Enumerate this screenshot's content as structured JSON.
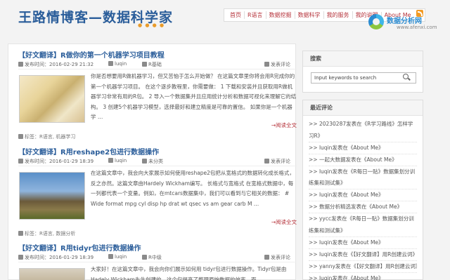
{
  "header": {
    "logo": "王路情博客—数据科学家",
    "logo_dots": "● ● ● ●"
  },
  "nav": {
    "items": [
      "首页",
      "R语言",
      "数据挖掘",
      "数据科学",
      "我的服务",
      "我的说明",
      "About Me"
    ]
  },
  "watermark": {
    "title": "数据分析网",
    "url": "www.afenxi.com"
  },
  "posts": [
    {
      "title": "【好文翻译】R做你的第一个机器学习项目教程",
      "date": "发布时间：2016-02-29 21:32",
      "author": "luqin",
      "category": "R基础",
      "comment": "发表评论",
      "excerpt": "你是否想要用R做机器学习，但又苦恼于怎么开始做？ 在这篇文章里你将会用R完成你的第一个机器学习项目。 在这个逐步教程里，你需要做： 1 下载和安装并且获取用R做机器学习非常有用的R包。 2 导入一个数据集并且应用统计分析和数据可视化来理解它的结构。 3 创建5个机器学习模型，选择最好和建立精度是可靠的置信。 如果你是一个机器学 …",
      "more": "→阅读全文",
      "tags": "标签：R语言, 机器学习"
    },
    {
      "title": "【好文翻译】R用reshape2包进行数据操作",
      "date": "发布时间：2016-01-29 18:39",
      "author": "luqin",
      "category": "未分类",
      "comment": "发表评论",
      "excerpt": "在这篇文章中，我会向大家展示如何使用reshape2包把从宽格式的数据转化成长格式，反之亦然。这篇文章由Hardely Wickham编写。 长格式与宽格式 在宽格式数据中，每一列都代表一个变量。例如，在mtcars数据集中，我们可以看到与它相关的数据： # Wide format mpg cyl disp hp drat wt qsec vs am gear carb M …",
      "more": "→阅读全文",
      "tags": "标签：R语言, 数据分析"
    },
    {
      "title": "【好文翻译】R用tidyr包进行数据操作",
      "date": "发布时间：2016-01-29 18:39",
      "author": "luqin",
      "category": "R中级",
      "comment": "发表评论",
      "excerpt": "大家好！在这篇文章中，我会向你们展示如何用 tidyr包进行数据操作。Tidyr包是由Hadely Wickham先生创建的，这个包提高了整理原始数据的效率，而",
      "more": "",
      "tags": ""
    }
  ],
  "sidebar": {
    "search": {
      "title": "搜索",
      "placeholder": "Input keywords to search"
    },
    "recent": {
      "title": "最近评论",
      "items": [
        ">> 20230287发表在《R学习路线》怎样学习R》",
        ">> luqin发表在《About Me》",
        ">> 一起大数据发表在《About Me》",
        ">> luqin发表在《R每日一贴》数据集划分训练集和测试集》",
        ">> luqin发表在《About Me》",
        ">> 数据分析精选发表在《About Me》",
        ">> yycc发表在《R每日一贴》数据集划分训练集和测试集》",
        ">> luqin发表在《About Me》",
        ">> luqin发表在《【好文翻译】用R创建云词》",
        ">> yanny发表在《【好文翻译】用R创建云词》",
        ">> luqin发表在《About Me》"
      ]
    }
  }
}
